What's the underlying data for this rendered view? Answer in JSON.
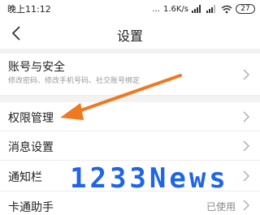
{
  "status_bar": {
    "time": "晚上11:12",
    "dots": "...",
    "network_speed": "1.6K/s",
    "battery": "27"
  },
  "nav": {
    "back_icon": "chevron-left-icon",
    "title": "设置"
  },
  "settings": [
    {
      "title": "账号与安全",
      "subtitle": "修改密码、修改手机号码、社交账号绑定",
      "value": ""
    },
    {
      "title": "权限管理",
      "subtitle": "",
      "value": ""
    },
    {
      "title": "消息设置",
      "subtitle": "",
      "value": ""
    },
    {
      "title": "通知栏",
      "subtitle": "",
      "value": ""
    },
    {
      "title": "卡通助手",
      "subtitle": "",
      "value": "已使用"
    }
  ],
  "watermark": "1233News",
  "colors": {
    "arrow": "#f0781e",
    "watermark": "#1e66e6"
  }
}
